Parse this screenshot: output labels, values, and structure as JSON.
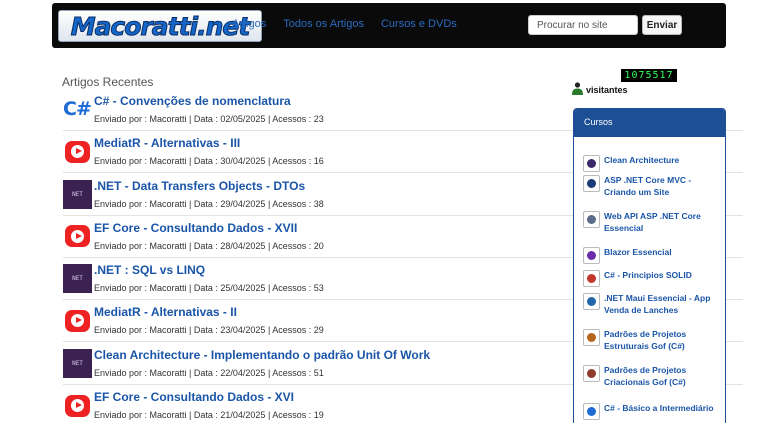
{
  "logo": {
    "text": "Macoratti.net"
  },
  "nav": {
    "links": [
      "Artigos",
      "Todos os Artigos",
      "Cursos e DVDs"
    ],
    "search_placeholder": "Procurar no site",
    "search_button": "Enviar"
  },
  "articles_section": {
    "title": "Artigos Recentes"
  },
  "articles": [
    {
      "thumb": "csharp-logo",
      "thumb_text": "C#",
      "title": "C# - Convenções de nomenclatura",
      "meta": "Enviado por : Macoratti | Data : 02/05/2025 | Acessos : 23"
    },
    {
      "thumb": "youtube-logo",
      "title": "MediatR - Alternativas - III",
      "meta": "Enviado por : Macoratti | Data : 30/04/2025 | Acessos : 16"
    },
    {
      "thumb": "dotnet-logo",
      "title": ".NET - Data Transfers Objects - DTOs",
      "meta": "Enviado por : Macoratti | Data : 29/04/2025 | Acessos : 38"
    },
    {
      "thumb": "youtube-logo",
      "title": "EF Core - Consultando Dados - XVII",
      "meta": "Enviado por : Macoratti | Data : 28/04/2025 | Acessos : 20"
    },
    {
      "thumb": "dotnet-logo",
      "title": ".NET : SQL vs LINQ",
      "meta": "Enviado por : Macoratti | Data : 25/04/2025 | Acessos : 53"
    },
    {
      "thumb": "youtube-logo",
      "title": "MediatR - Alternativas - II",
      "meta": "Enviado por : Macoratti | Data : 23/04/2025 | Acessos : 29"
    },
    {
      "thumb": "dotnet-logo",
      "title": "Clean Architecture - Implementando o padrão Unit Of Work",
      "meta": "Enviado por : Macoratti | Data : 22/04/2025 | Acessos : 51"
    },
    {
      "thumb": "youtube-logo",
      "title": "EF Core - Consultando Dados - XVI",
      "meta": "Enviado por : Macoratti | Data : 21/04/2025 | Acessos : 19"
    }
  ],
  "visitors": {
    "count": "1075517",
    "label": "visitantes"
  },
  "courses": {
    "title": "Cursos",
    "items": [
      {
        "label": "Clean Architecture",
        "color": "#3a2a6a"
      },
      {
        "label": "ASP .NET Core MVC - Criando um Site",
        "color": "#1a3a7a"
      },
      {
        "label": "Web API ASP .NET Core Essencial",
        "color": "#5b6b8a"
      },
      {
        "label": "Blazor Essencial",
        "color": "#6a2ca8"
      },
      {
        "label": "C# - Principios SOLID",
        "color": "#c0392b"
      },
      {
        "label": ".NET Maui Essencial - App Venda de Lanches",
        "color": "#2266aa"
      },
      {
        "label": "Padrões de Projetos Estruturais Gof (C#)",
        "color": "#b5651d"
      },
      {
        "label": "Padrões de Projetos Criacionais Gof (C#)",
        "color": "#8e3b2c"
      },
      {
        "label": "C# - Básico a Intermediário",
        "color": "#1e6bd6"
      }
    ]
  },
  "colors": {
    "navbar": "#0a0a0a",
    "link": "#1a55a8",
    "sidebar_header": "#1c4f96",
    "youtube": "#ee2222",
    "counter_digits": "#34ff5a"
  }
}
